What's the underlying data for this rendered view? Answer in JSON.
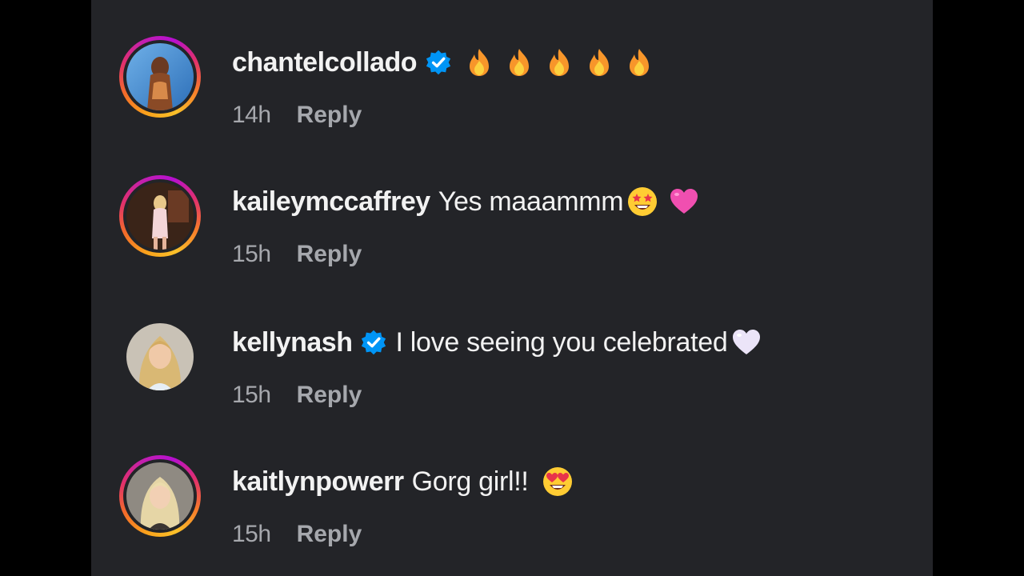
{
  "comments": [
    {
      "username": "chantelcollado",
      "verified": true,
      "text": "",
      "emojis": [
        "fire",
        "fire",
        "fire",
        "fire",
        "fire"
      ],
      "time": "14h",
      "reply_label": "Reply",
      "story_ring": true
    },
    {
      "username": "kaileymccaffrey",
      "verified": false,
      "text": "Yes maaammm",
      "emojis": [
        "star-struck",
        "pink-heart"
      ],
      "time": "15h",
      "reply_label": "Reply",
      "story_ring": true
    },
    {
      "username": "kellynash",
      "verified": true,
      "text": "I love seeing you celebrated",
      "emojis": [
        "white-heart"
      ],
      "time": "15h",
      "reply_label": "Reply",
      "story_ring": false
    },
    {
      "username": "kaitlynpowerr",
      "verified": false,
      "text": "Gorg girl!!",
      "emojis": [
        "heart-eyes"
      ],
      "time": "15h",
      "reply_label": "Reply",
      "story_ring": true
    }
  ],
  "colors": {
    "background": "#232428",
    "text": "#f2f2f2",
    "meta": "#a6a8ad",
    "verified": "#0095f6"
  }
}
